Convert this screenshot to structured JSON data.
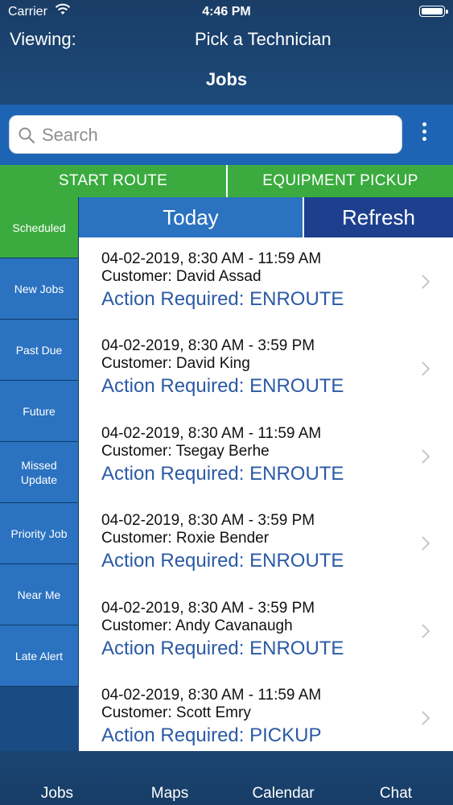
{
  "status_bar": {
    "carrier": "Carrier",
    "time": "4:46 PM"
  },
  "header": {
    "viewing_label": "Viewing:",
    "technician": "Pick a Technician",
    "title": "Jobs"
  },
  "search": {
    "placeholder": "Search",
    "value": ""
  },
  "actions": {
    "start_route": "START ROUTE",
    "equipment_pickup": "EQUIPMENT PICKUP"
  },
  "sidebar": {
    "items": [
      {
        "label": "Scheduled",
        "active": true
      },
      {
        "label": "New Jobs"
      },
      {
        "label": "Past Due"
      },
      {
        "label": "Future"
      },
      {
        "label": "Missed Update"
      },
      {
        "label": "Priority Job"
      },
      {
        "label": "Near Me"
      },
      {
        "label": "Late Alert"
      }
    ]
  },
  "tabs": {
    "today": "Today",
    "refresh": "Refresh"
  },
  "jobs": [
    {
      "datetime": "04-02-2019, 8:30 AM - 11:59 AM",
      "customer": "Customer: David Assad",
      "action": "Action Required: ENROUTE"
    },
    {
      "datetime": "04-02-2019, 8:30 AM - 3:59 PM",
      "customer": "Customer: David King",
      "action": "Action Required: ENROUTE"
    },
    {
      "datetime": "04-02-2019, 8:30 AM - 11:59 AM",
      "customer": "Customer: Tsegay Berhe",
      "action": "Action Required: ENROUTE"
    },
    {
      "datetime": "04-02-2019, 8:30 AM - 3:59 PM",
      "customer": "Customer: Roxie Bender",
      "action": "Action Required: ENROUTE"
    },
    {
      "datetime": "04-02-2019, 8:30 AM - 3:59 PM",
      "customer": "Customer: Andy Cavanaugh",
      "action": "Action Required: ENROUTE"
    },
    {
      "datetime": "04-02-2019, 8:30 AM - 11:59 AM",
      "customer": "Customer: Scott Emry",
      "action": "Action Required: PICKUP"
    }
  ],
  "bottom_tabs": {
    "jobs": "Jobs",
    "maps": "Maps",
    "calendar": "Calendar",
    "chat": "Chat"
  },
  "colors": {
    "header": "#1a3d66",
    "accent_blue": "#2b72c0",
    "green": "#3bab3f",
    "refresh": "#1d3f8e",
    "action_text": "#2b5aa6"
  }
}
